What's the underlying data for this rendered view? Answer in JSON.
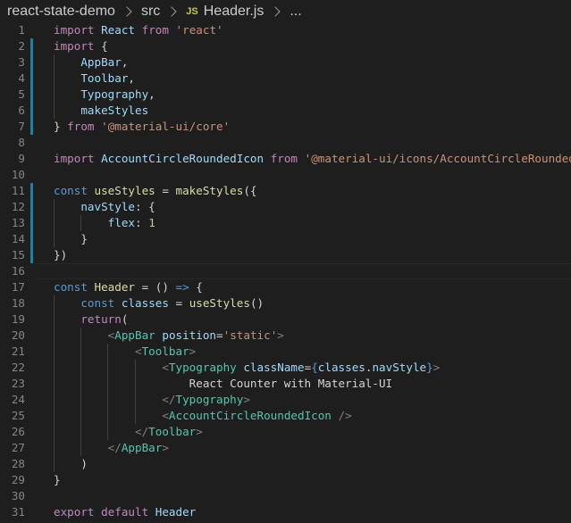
{
  "breadcrumb": {
    "folder": "react-state-demo",
    "subfolder": "src",
    "file_badge": "JS",
    "file": "Header.js",
    "more": "..."
  },
  "colors": {
    "background": "#1e1e1e",
    "keyword": "#569cd6",
    "control_keyword": "#c586c0",
    "variable": "#9cdcfe",
    "function": "#dcdcaa",
    "string": "#ce9178",
    "number": "#b5cea8",
    "component": "#4ec9b0",
    "bracket": "#808080",
    "line_number": "#858585",
    "modified_marker": "#1b81a8"
  },
  "lines": [
    {
      "n": "1",
      "tokens": [
        [
          "imp",
          "import"
        ],
        [
          "pl",
          " "
        ],
        [
          "var",
          "React"
        ],
        [
          "pl",
          " "
        ],
        [
          "imp",
          "from"
        ],
        [
          "pl",
          " "
        ],
        [
          "str",
          "'react'"
        ]
      ]
    },
    {
      "n": "2",
      "tokens": [
        [
          "imp",
          "import"
        ],
        [
          "pl",
          " {"
        ]
      ]
    },
    {
      "n": "3",
      "tokens": [
        [
          "pl",
          "    "
        ],
        [
          "var",
          "AppBar"
        ],
        [
          "pl",
          ","
        ]
      ]
    },
    {
      "n": "4",
      "tokens": [
        [
          "pl",
          "    "
        ],
        [
          "var",
          "Toolbar"
        ],
        [
          "pl",
          ","
        ]
      ]
    },
    {
      "n": "5",
      "tokens": [
        [
          "pl",
          "    "
        ],
        [
          "var",
          "Typography"
        ],
        [
          "pl",
          ","
        ]
      ]
    },
    {
      "n": "6",
      "tokens": [
        [
          "pl",
          "    "
        ],
        [
          "var",
          "makeStyles"
        ]
      ]
    },
    {
      "n": "7",
      "tokens": [
        [
          "pl",
          "} "
        ],
        [
          "imp",
          "from"
        ],
        [
          "pl",
          " "
        ],
        [
          "str",
          "'@material-ui/core'"
        ]
      ]
    },
    {
      "n": "8",
      "tokens": []
    },
    {
      "n": "9",
      "tokens": [
        [
          "imp",
          "import"
        ],
        [
          "pl",
          " "
        ],
        [
          "var",
          "AccountCircleRoundedIcon"
        ],
        [
          "pl",
          " "
        ],
        [
          "imp",
          "from"
        ],
        [
          "pl",
          " "
        ],
        [
          "str",
          "'@material-ui/icons/AccountCircleRounded'"
        ],
        [
          "pl",
          ";"
        ]
      ]
    },
    {
      "n": "10",
      "tokens": []
    },
    {
      "n": "11",
      "tokens": [
        [
          "kw",
          "const"
        ],
        [
          "pl",
          " "
        ],
        [
          "fn",
          "useStyles"
        ],
        [
          "pl",
          " = "
        ],
        [
          "fn",
          "makeStyles"
        ],
        [
          "pl",
          "({"
        ]
      ]
    },
    {
      "n": "12",
      "tokens": [
        [
          "pl",
          "    "
        ],
        [
          "var",
          "navStyle"
        ],
        [
          "pl",
          ": {"
        ]
      ]
    },
    {
      "n": "13",
      "tokens": [
        [
          "pl",
          "        "
        ],
        [
          "var",
          "flex"
        ],
        [
          "pl",
          ": "
        ],
        [
          "num",
          "1"
        ]
      ]
    },
    {
      "n": "14",
      "tokens": [
        [
          "pl",
          "    }"
        ]
      ]
    },
    {
      "n": "15",
      "tokens": [
        [
          "pl",
          "})"
        ]
      ]
    },
    {
      "n": "16",
      "tokens": []
    },
    {
      "n": "17",
      "tokens": [
        [
          "kw",
          "const"
        ],
        [
          "pl",
          " "
        ],
        [
          "fn",
          "Header"
        ],
        [
          "pl",
          " = () "
        ],
        [
          "kw",
          "=>"
        ],
        [
          "pl",
          " {"
        ]
      ]
    },
    {
      "n": "18",
      "tokens": [
        [
          "pl",
          "    "
        ],
        [
          "kw",
          "const"
        ],
        [
          "pl",
          " "
        ],
        [
          "var",
          "classes"
        ],
        [
          "pl",
          " = "
        ],
        [
          "fn",
          "useStyles"
        ],
        [
          "pl",
          "()"
        ]
      ]
    },
    {
      "n": "19",
      "tokens": [
        [
          "pl",
          "    "
        ],
        [
          "imp",
          "return"
        ],
        [
          "pl",
          "("
        ]
      ]
    },
    {
      "n": "20",
      "tokens": [
        [
          "pl",
          "        "
        ],
        [
          "br",
          "<"
        ],
        [
          "tag",
          "AppBar"
        ],
        [
          "pl",
          " "
        ],
        [
          "var",
          "position"
        ],
        [
          "pl",
          "="
        ],
        [
          "str",
          "'static'"
        ],
        [
          "br",
          ">"
        ]
      ]
    },
    {
      "n": "21",
      "tokens": [
        [
          "pl",
          "            "
        ],
        [
          "br",
          "<"
        ],
        [
          "tag",
          "Toolbar"
        ],
        [
          "br",
          ">"
        ]
      ]
    },
    {
      "n": "22",
      "tokens": [
        [
          "pl",
          "                "
        ],
        [
          "br",
          "<"
        ],
        [
          "tag",
          "Typography"
        ],
        [
          "pl",
          " "
        ],
        [
          "var",
          "className"
        ],
        [
          "pl",
          "="
        ],
        [
          "kw",
          "{"
        ],
        [
          "var",
          "classes"
        ],
        [
          "pl",
          "."
        ],
        [
          "var",
          "navStyle"
        ],
        [
          "kw",
          "}"
        ],
        [
          "br",
          ">"
        ]
      ]
    },
    {
      "n": "23",
      "tokens": [
        [
          "pl",
          "                    "
        ],
        [
          "jsxtext",
          "React Counter with Material-UI"
        ]
      ]
    },
    {
      "n": "24",
      "tokens": [
        [
          "pl",
          "                "
        ],
        [
          "br",
          "</"
        ],
        [
          "tag",
          "Typography"
        ],
        [
          "br",
          ">"
        ]
      ]
    },
    {
      "n": "25",
      "tokens": [
        [
          "pl",
          "                "
        ],
        [
          "br",
          "<"
        ],
        [
          "tag",
          "AccountCircleRoundedIcon"
        ],
        [
          "pl",
          " "
        ],
        [
          "br",
          "/>"
        ]
      ]
    },
    {
      "n": "26",
      "tokens": [
        [
          "pl",
          "            "
        ],
        [
          "br",
          "</"
        ],
        [
          "tag",
          "Toolbar"
        ],
        [
          "br",
          ">"
        ]
      ]
    },
    {
      "n": "27",
      "tokens": [
        [
          "pl",
          "        "
        ],
        [
          "br",
          "</"
        ],
        [
          "tag",
          "AppBar"
        ],
        [
          "br",
          ">"
        ]
      ]
    },
    {
      "n": "28",
      "tokens": [
        [
          "pl",
          "    )"
        ]
      ]
    },
    {
      "n": "29",
      "tokens": [
        [
          "pl",
          "}"
        ]
      ]
    },
    {
      "n": "30",
      "tokens": []
    },
    {
      "n": "31",
      "tokens": [
        [
          "imp",
          "export"
        ],
        [
          "pl",
          " "
        ],
        [
          "imp",
          "default"
        ],
        [
          "pl",
          " "
        ],
        [
          "var",
          "Header"
        ]
      ]
    }
  ]
}
